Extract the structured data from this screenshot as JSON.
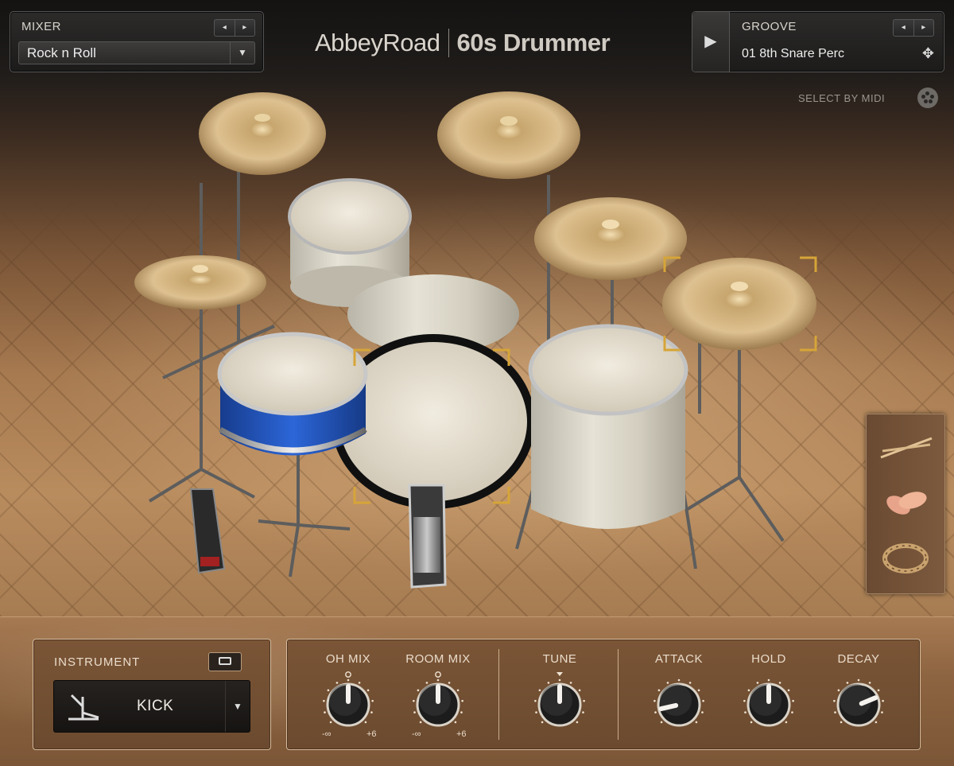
{
  "header": {
    "brand_main": "AbbeyRoad",
    "brand_sub": "60s Drummer"
  },
  "mixer": {
    "label": "MIXER",
    "prev_icon": "◂",
    "next_icon": "▸",
    "value": "Rock n Roll",
    "caret": "▼"
  },
  "groove": {
    "label": "GROOVE",
    "play_icon": "▶",
    "prev_icon": "◂",
    "next_icon": "▸",
    "value": "01 8th Snare Perc",
    "drag_icon": "✥"
  },
  "select_by_midi": {
    "label": "SELECT BY MIDI"
  },
  "articulations": {
    "items": [
      "sticks-icon",
      "brushes-hands-icon",
      "tambourine-icon"
    ]
  },
  "instrument": {
    "label": "INSTRUMENT",
    "value": "KICK",
    "caret": "▼"
  },
  "knobs": {
    "oh_mix": {
      "label": "OH MIX",
      "min": "-∞",
      "max": "+6",
      "value_fraction": 0.5
    },
    "room_mix": {
      "label": "ROOM MIX",
      "min": "-∞",
      "max": "+6",
      "value_fraction": 0.5
    },
    "tune": {
      "label": "TUNE",
      "value_fraction": 0.5
    },
    "attack": {
      "label": "ATTACK",
      "value_fraction": 0.12
    },
    "hold": {
      "label": "HOLD",
      "value_fraction": 0.5
    },
    "decay": {
      "label": "DECAY",
      "value_fraction": 0.75
    }
  },
  "colors": {
    "selection_bracket": "#d6a538",
    "snare_wrap": "#1f4fb8",
    "panel_brown": "#7a5536"
  }
}
